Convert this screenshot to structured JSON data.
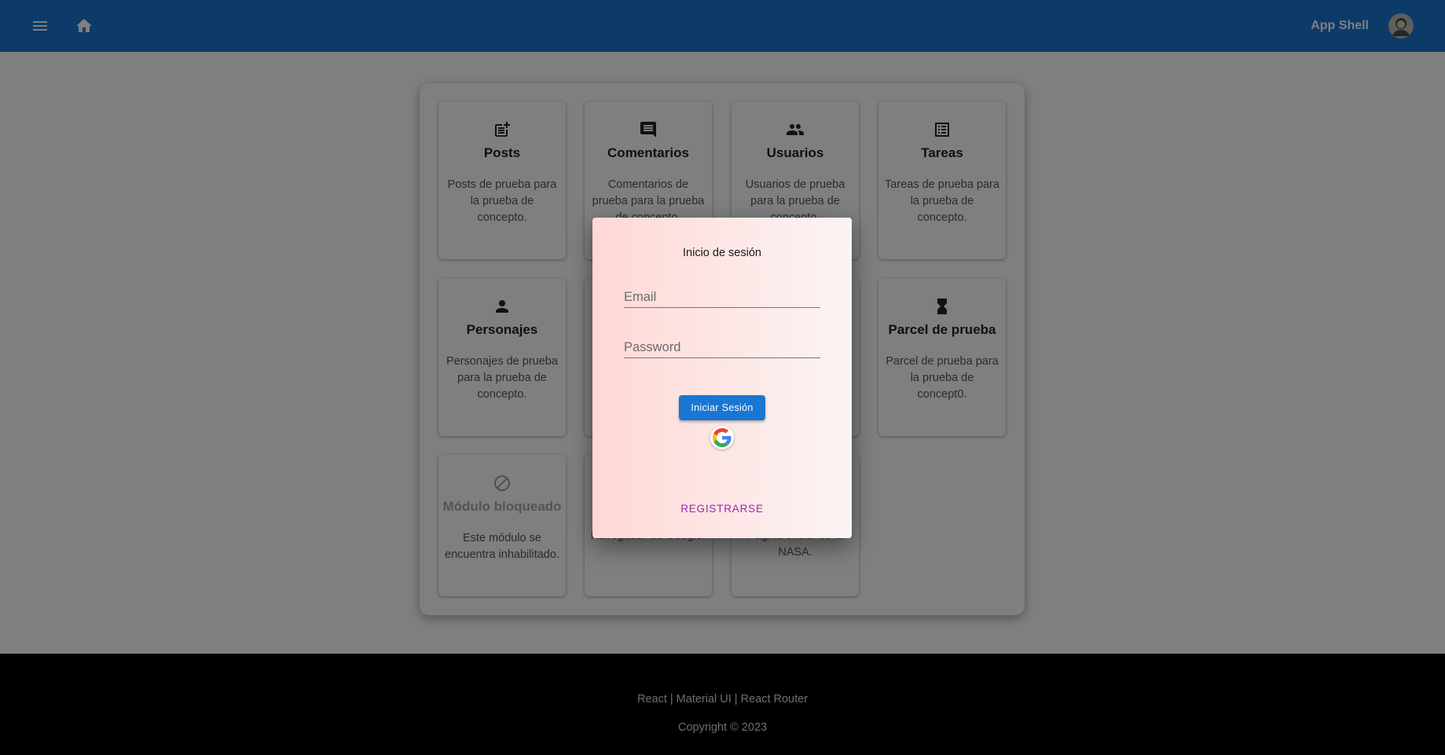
{
  "header": {
    "title": "App Shell",
    "menu_icon": "menu-icon",
    "home_icon": "home-icon",
    "avatar_icon": "account-avatar",
    "color": "#1976d2"
  },
  "cards": [
    {
      "title": "Posts",
      "description": "Posts de prueba para la prueba de concepto.",
      "icon": "post-add-icon"
    },
    {
      "title": "Comentarios",
      "description": "Comentarios de prueba para la prueba de concepto.",
      "icon": "comment-icon"
    },
    {
      "title": "Usuarios",
      "description": "Usuarios de prueba para la prueba de concepto.",
      "icon": "people-icon"
    },
    {
      "title": "Tareas",
      "description": "Tareas de prueba para la prueba de concepto.",
      "icon": "list-icon"
    },
    {
      "title": "Personajes",
      "description": "Personajes de prueba para la prueba de concepto.",
      "icon": "person-icon"
    },
    {
      "title": "",
      "description": "",
      "icon": ""
    },
    {
      "title": "",
      "description": "",
      "icon": ""
    },
    {
      "title": "Parcel de prueba",
      "description": "Parcel de prueba para la prueba de concept0.",
      "icon": "hourglass-icon"
    },
    {
      "title": "Módulo bloqueado",
      "description": "Este módulo se encuentra inhabilitado.",
      "icon": "block-icon"
    },
    {
      "title": "",
      "description": "Navegador de Google.",
      "icon": ""
    },
    {
      "title": "",
      "description": "Página oficial de la NASA.",
      "icon": ""
    }
  ],
  "dialog": {
    "title": "Inicio de sesión",
    "email_placeholder": "Email",
    "password_placeholder": "Password",
    "login_button": "Iniciar Sesión",
    "google_icon": "google-icon",
    "register_button": "REGISTRARSE"
  },
  "footer": {
    "links": "React | Material UI | React Router",
    "copyright": "Copyright © 2023"
  }
}
